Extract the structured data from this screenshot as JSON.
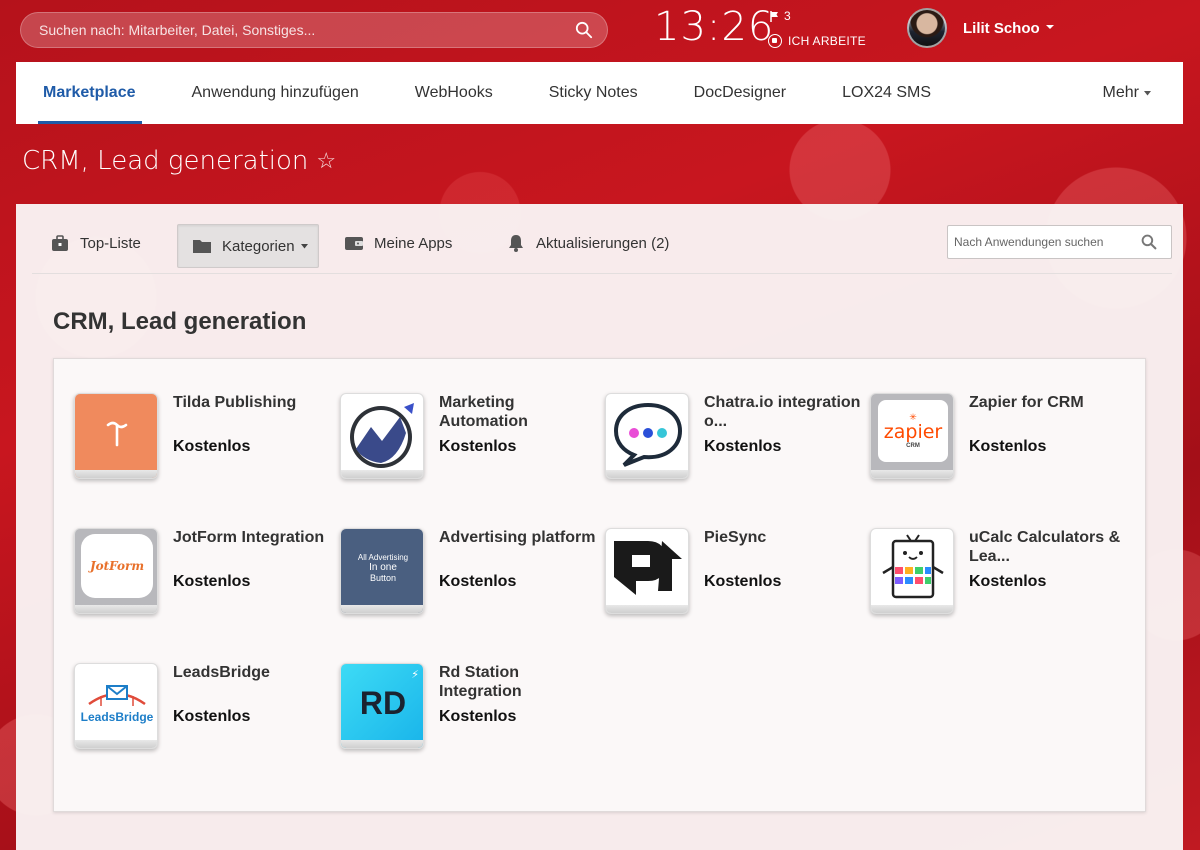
{
  "topbar": {
    "search_placeholder": "Suchen nach: Mitarbeiter, Datei, Sonstiges...",
    "clock": "13:26",
    "flag_count": "3",
    "work_status": "ICH ARBEITE",
    "user_name": "Lilit Schoo"
  },
  "tabs": [
    {
      "label": "Marketplace",
      "active": true
    },
    {
      "label": "Anwendung hinzufügen"
    },
    {
      "label": "WebHooks"
    },
    {
      "label": "Sticky Notes"
    },
    {
      "label": "DocDesigner"
    },
    {
      "label": "LOX24 SMS"
    }
  ],
  "tab_more": "Mehr",
  "page_title": "CRM, Lead generation",
  "toolbar": {
    "top_list": "Top-Liste",
    "categories": "Kategorien",
    "my_apps": "Meine Apps",
    "updates": "Aktualisierungen (2)",
    "search_placeholder": "Nach Anwendungen suchen"
  },
  "section_heading": "CRM, Lead generation",
  "apps": [
    {
      "name": "Tilda Publishing",
      "price": "Kostenlos",
      "icon": "tilda-logo"
    },
    {
      "name": "Marketing Automation",
      "price": "Kostenlos",
      "icon": "marketing-automation-logo"
    },
    {
      "name": "Chatra.io integration  o...",
      "price": "Kostenlos",
      "icon": "chatra-logo"
    },
    {
      "name": "Zapier for CRM",
      "price": "Kostenlos",
      "icon": "zapier-logo",
      "logo_text": "zapier",
      "logo_sub": "CRM"
    },
    {
      "name": "JotForm Integration",
      "price": "Kostenlos",
      "icon": "jotform-logo",
      "logo_text": "JotForm"
    },
    {
      "name": "Advertising platform",
      "price": "Kostenlos",
      "icon": "advertising-logo",
      "logo_lines": [
        "All Advertising",
        "In one",
        "Button"
      ]
    },
    {
      "name": "PieSync",
      "price": "Kostenlos",
      "icon": "piesync-logo"
    },
    {
      "name": "uCalc  Calculators & Lea...",
      "price": "Kostenlos",
      "icon": "ucalc-logo"
    },
    {
      "name": "LeadsBridge",
      "price": "Kostenlos",
      "icon": "leadsbridge-logo",
      "logo_text": "LeadsBridge"
    },
    {
      "name": "Rd Station Integration",
      "price": "Kostenlos",
      "icon": "rdstation-logo",
      "logo_text": "RD"
    }
  ],
  "colors": {
    "brand_red": "#b5121b",
    "active_tab": "#1f5ba8",
    "tilda": "#f08a5d",
    "zapier": "#ff4a00",
    "rdstation": "#29c6ef",
    "advertising": "#4a5f80"
  }
}
